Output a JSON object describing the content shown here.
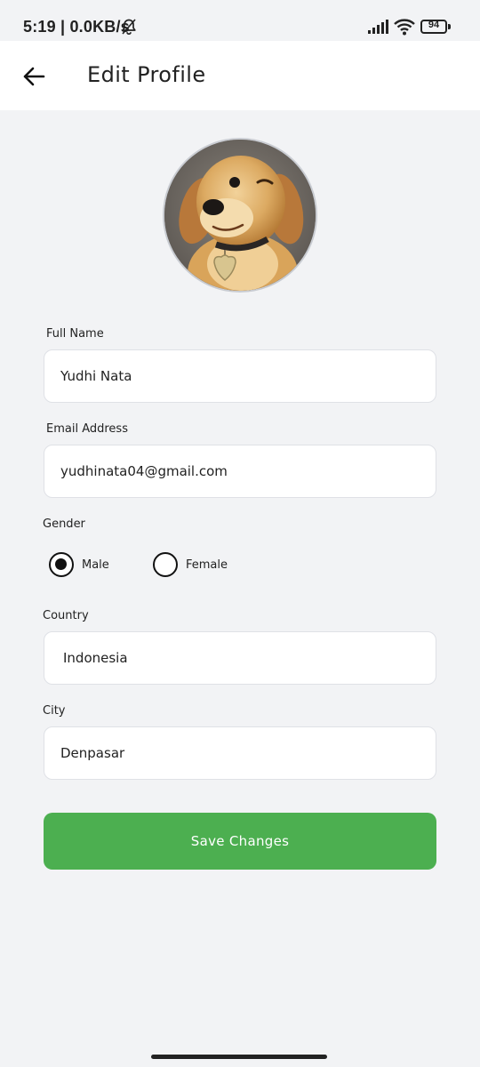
{
  "status_bar": {
    "time": "5:19 | 0.0KB/s",
    "battery": "94"
  },
  "header": {
    "title": "Edit Profile"
  },
  "form": {
    "full_name": {
      "label": "Full Name",
      "value": "Yudhi Nata"
    },
    "email": {
      "label": "Email Address",
      "value": "yudhinata04@gmail.com"
    },
    "gender": {
      "label": "Gender",
      "options": [
        {
          "label": "Male",
          "selected": true
        },
        {
          "label": "Female",
          "selected": false
        }
      ]
    },
    "country": {
      "label": "Country",
      "value": "Indonesia"
    },
    "city": {
      "label": "City",
      "value": "Denpasar"
    }
  },
  "actions": {
    "save_label": "Save Changes"
  },
  "colors": {
    "accent": "#4caf50",
    "background": "#f2f3f5"
  }
}
